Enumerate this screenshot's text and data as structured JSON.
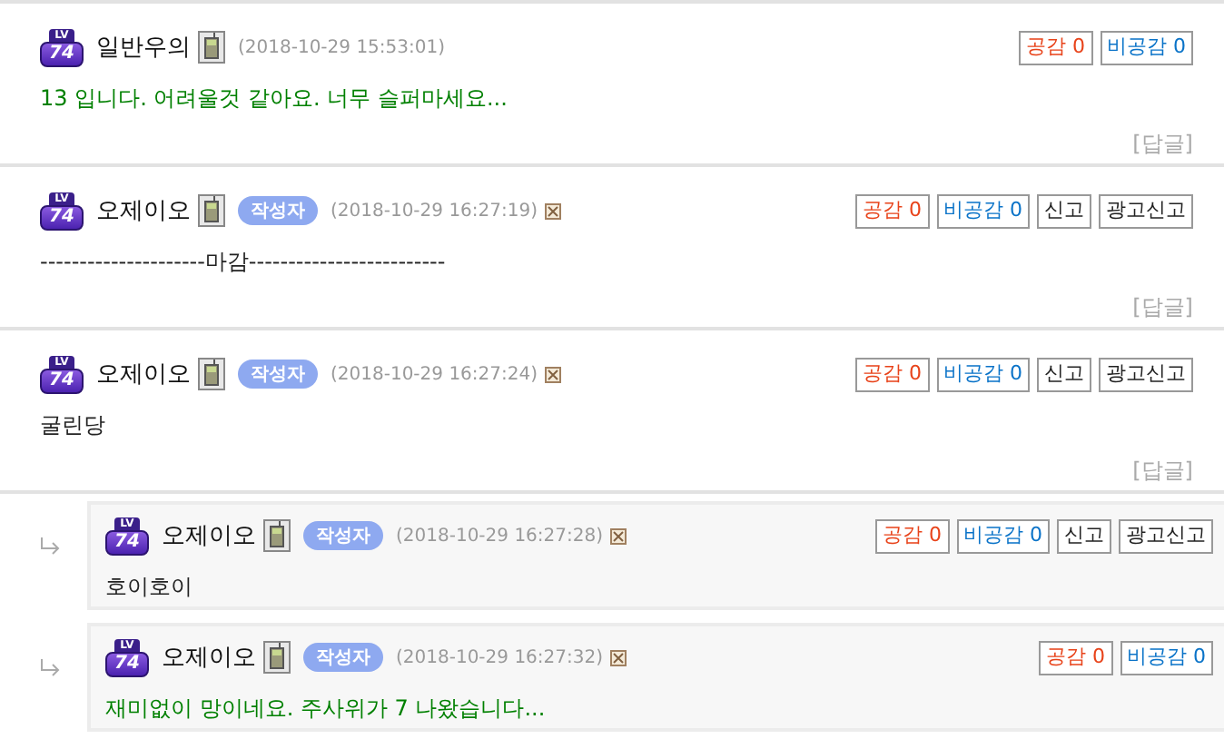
{
  "comments": [
    {
      "kind": "top",
      "rank_label": "LV",
      "rank": "74",
      "author": "일반우의",
      "time": "(2018-10-29 15:53:01)",
      "deletable": false,
      "body": "13 입니다. 어려울것 같아요. 너무 슬퍼마세요...",
      "color": "#008000",
      "actions": [
        {
          "kind": "agree",
          "label": "공감",
          "count": "0"
        },
        {
          "kind": "disagree",
          "label": "비공감",
          "count": "0"
        }
      ],
      "reply_link": "[답글]"
    },
    {
      "kind": "top",
      "rank_label": "LV",
      "rank": "74",
      "author": "오제이오",
      "writer_badge": "작성자",
      "time": "(2018-10-29 16:27:19)",
      "deletable": true,
      "body": "---------------------마감-------------------------",
      "color": "#222222",
      "actions": [
        {
          "kind": "agree",
          "label": "공감",
          "count": "0"
        },
        {
          "kind": "disagree",
          "label": "비공감",
          "count": "0"
        },
        {
          "kind": "report",
          "label": "신고"
        },
        {
          "kind": "report",
          "label": "광고신고"
        }
      ],
      "reply_link": "[답글]"
    },
    {
      "kind": "top",
      "rank_label": "LV",
      "rank": "74",
      "author": "오제이오",
      "writer_badge": "작성자",
      "time": "(2018-10-29 16:27:24)",
      "deletable": true,
      "body": "굴린당",
      "color": "#222222",
      "actions": [
        {
          "kind": "agree",
          "label": "공감",
          "count": "0"
        },
        {
          "kind": "disagree",
          "label": "비공감",
          "count": "0"
        },
        {
          "kind": "report",
          "label": "신고"
        },
        {
          "kind": "report",
          "label": "광고신고"
        }
      ],
      "reply_link": "[답글]"
    },
    {
      "kind": "reply",
      "rank_label": "LV",
      "rank": "74",
      "author": "오제이오",
      "writer_badge": "작성자",
      "time": "(2018-10-29 16:27:28)",
      "deletable": true,
      "body": "호이호이",
      "color": "#222222",
      "actions": [
        {
          "kind": "agree",
          "label": "공감",
          "count": "0"
        },
        {
          "kind": "disagree",
          "label": "비공감",
          "count": "0"
        },
        {
          "kind": "report",
          "label": "신고"
        },
        {
          "kind": "report",
          "label": "광고신고"
        }
      ]
    },
    {
      "kind": "reply",
      "rank_label": "LV",
      "rank": "74",
      "author": "오제이오",
      "writer_badge": "작성자",
      "time": "(2018-10-29 16:27:32)",
      "deletable": true,
      "body": "재미없이 망이네요. 주사위가 7 나왔습니다...",
      "color": "#008000",
      "actions": [
        {
          "kind": "agree",
          "label": "공감",
          "count": "0"
        },
        {
          "kind": "disagree",
          "label": "비공감",
          "count": "0"
        }
      ]
    }
  ]
}
